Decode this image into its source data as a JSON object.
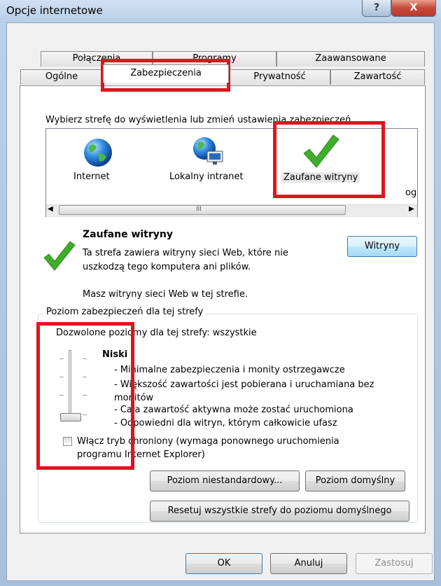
{
  "window": {
    "title": "Opcje internetowe",
    "help_label": "?",
    "close_label": "X"
  },
  "tabs": {
    "row1": [
      "Połączenia",
      "Programy",
      "Zaawansowane"
    ],
    "row2": [
      "Ogólne",
      "Zabezpieczenia",
      "Prywatność",
      "Zawartość"
    ],
    "active": "Zabezpieczenia"
  },
  "zone": {
    "prompt": "Wybierz strefę do wyświetlenia lub zmień ustawienia zabezpieczeń.",
    "zones": [
      {
        "label": "Internet",
        "icon": "globe-icon"
      },
      {
        "label": "Lokalny intranet",
        "icon": "globe-network-icon"
      },
      {
        "label": "Zaufane witryny",
        "icon": "green-check-icon"
      },
      {
        "label": "og",
        "icon": ""
      }
    ],
    "scroll_glyph": "III"
  },
  "selected_zone": {
    "title": "Zaufane witryny",
    "description": "Ta strefa zawiera witryny sieci Web, które nie uszkodzą tego komputera ani plików.",
    "sites_note": "Masz witryny sieci Web w tej strefie.",
    "sites_button": "Witryny"
  },
  "security_level": {
    "group_title": "Poziom zabezpieczeń dla tej strefy",
    "allowed": "Dozwolone poziomy dla tej strefy: wszystkie",
    "level_name": "Niski",
    "bullets": [
      "- Minimalne zabezpieczenia i monity ostrzegawcze",
      "- Większość zawartości jest pobierana i uruchamiana bez monitów",
      "- Cała zawartość aktywna może zostać uruchomiona",
      "- Odpowiedni dla witryn, którym całkowicie ufasz"
    ],
    "slider_level": "lowest",
    "protected_mode": {
      "label": "Włącz tryb chroniony (wymaga ponownego uruchomienia programu Internet Explorer)",
      "checked": false
    },
    "custom_button": "Poziom niestandardowy...",
    "default_button": "Poziom domyślny",
    "reset_button": "Resetuj wszystkie strefy do poziomu domyślnego"
  },
  "footer": {
    "ok": "OK",
    "cancel": "Anuluj",
    "apply": "Zastosuj"
  },
  "colors": {
    "highlight": "#e0141e",
    "check": "#3fae2a"
  }
}
